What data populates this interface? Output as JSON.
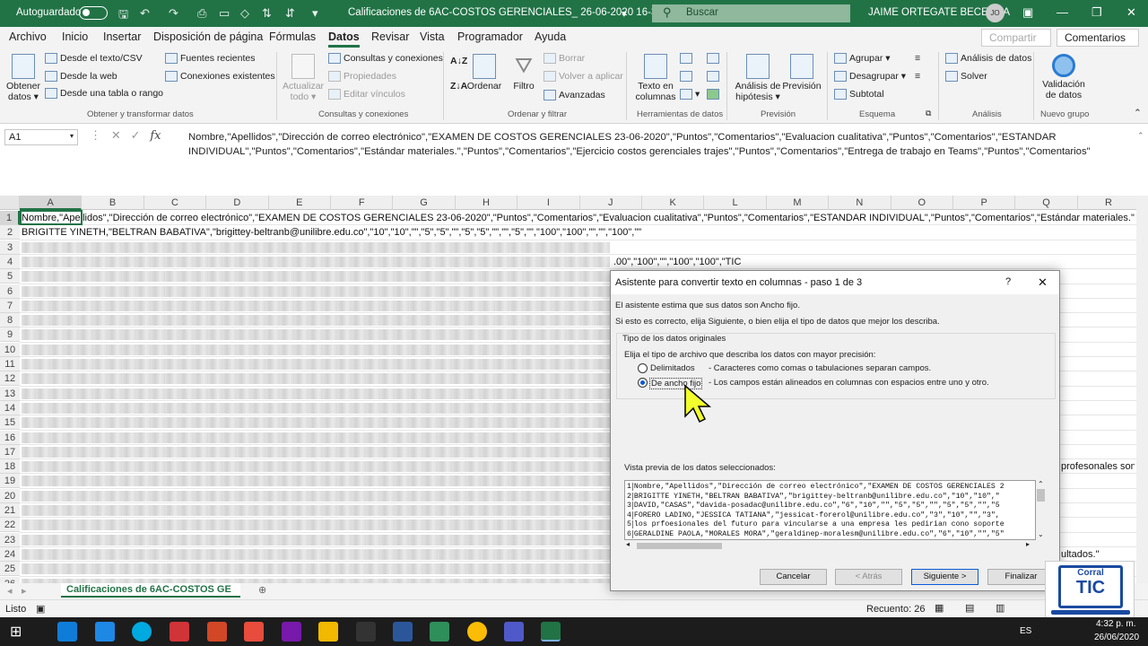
{
  "titlebar": {
    "autosave": "Autoguardado",
    "filename": "Calificaciones de 6AC-COSTOS GERENCIALES_ 26-06-2020 16-31.csv",
    "search": "Buscar",
    "user": "JAIME ORTEGATE BECERRA",
    "initials": "JO"
  },
  "menu": {
    "items": [
      "Archivo",
      "Inicio",
      "Insertar",
      "Disposición de página",
      "Fórmulas",
      "Datos",
      "Revisar",
      "Vista",
      "Programador",
      "Ayuda"
    ],
    "share": "Compartir",
    "comments": "Comentarios"
  },
  "ribbon": {
    "obtener": "Obtener",
    "datos": "datos",
    "desde_texto": "Desde el texto/CSV",
    "desde_web": "Desde la web",
    "desde_tabla": "Desde una tabla o rango",
    "fuentes": "Fuentes recientes",
    "conexiones": "Conexiones existentes",
    "g1": "Obtener y transformar datos",
    "actualizar": "Actualizar",
    "todo": "todo",
    "consultas": "Consultas y conexiones",
    "propiedades": "Propiedades",
    "editar": "Editar vínculos",
    "g2": "Consultas y conexiones",
    "ordenar": "Ordenar",
    "filtro": "Filtro",
    "borrar": "Borrar",
    "volver": "Volver a aplicar",
    "avanzadas": "Avanzadas",
    "g3": "Ordenar y filtrar",
    "texto": "Texto en",
    "columnas": "columnas",
    "g4": "Herramientas de datos",
    "analisis": "Análisis de",
    "hipotesis": "hipótesis",
    "prevision": "Previsión",
    "g5": "Previsión",
    "agrupar": "Agrupar",
    "desagrupar": "Desagrupar",
    "subtotal": "Subtotal",
    "g6": "Esquema",
    "analisis_datos": "Análisis de datos",
    "solver": "Solver",
    "g7": "Análisis",
    "validacion": "Validación",
    "de_datos": "de datos",
    "g8": "Nuevo grupo"
  },
  "formula": {
    "cell": "A1",
    "text": "Nombre,\"Apellidos\",\"Dirección de correo electrónico\",\"EXAMEN DE COSTOS GERENCIALES 23-06-2020\",\"Puntos\",\"Comentarios\",\"Evaluacion cualitativa\",\"Puntos\",\"Comentarios\",\"ESTANDAR INDIVIDUAL\",\"Puntos\",\"Comentarios\",\"Estándar materiales.\",\"Puntos\",\"Comentarios\",\"Ejercicio costos gerenciales trajes\",\"Puntos\",\"Comentarios\",\"Entrega de trabajo en Teams\",\"Puntos\",\"Comentarios\""
  },
  "columns": [
    "A",
    "B",
    "C",
    "D",
    "E",
    "F",
    "G",
    "H",
    "I",
    "J",
    "K",
    "L",
    "M",
    "N",
    "O",
    "P",
    "Q",
    "R"
  ],
  "rows": [
    "1",
    "2",
    "3",
    "4",
    "5",
    "6",
    "7",
    "8",
    "9",
    "10",
    "11",
    "12",
    "13",
    "14",
    "15",
    "16",
    "17",
    "18",
    "19",
    "20",
    "21",
    "22",
    "23",
    "24",
    "25",
    "26"
  ],
  "cells": {
    "r1": "Nombre,\"Apellidos\",\"Dirección de correo electrónico\",\"EXAMEN DE COSTOS GERENCIALES 23-06-2020\",\"Puntos\",\"Comentarios\",\"Evaluacion cualitativa\",\"Puntos\",\"Comentarios\",\"ESTANDAR INDIVIDUAL\",\"Puntos\",\"Comentarios\",\"Estándar materiales.\",\"Pu",
    "r2": "BRIGITTE YINETH,\"BELTRAN BABATIVA\",\"brigittey-beltranb@unilibre.edu.co\",\"10\",\"10\",\"\",\"5\",\"5\",\"\",\"5\",\"5\",\"\",\"\",\"5\",\"\",\"100\",\"100\",\"\",\"\",\"100\",\"\"",
    "r4": ".00\",\"100\",\"\",\"100\",\"100\",\"TIC",
    "r18": "profesonales son",
    "r24": "ultados.\""
  },
  "sheet": {
    "tab": "Calificaciones de 6AC-COSTOS GE"
  },
  "status": {
    "ready": "Listo",
    "count": "Recuento: 26"
  },
  "taskbar": {
    "lang": "ES",
    "time": "4:32 p. m.",
    "date": "26/06/2020"
  },
  "dialog": {
    "title": "Asistente para convertir texto en columnas - paso 1 de 3",
    "help": "?",
    "line1": "El asistente estima que sus datos son Ancho fijo.",
    "line2": "Si esto es correcto, elija Siguiente, o bien elija el tipo de datos que mejor los describa.",
    "group": "Tipo de los datos originales",
    "prompt": "Elija el tipo de archivo que describa los datos con mayor precisión:",
    "opt1": "Delimitados",
    "opt1desc": "- Caracteres como comas o tabulaciones separan campos.",
    "opt2": "De ancho fijo",
    "opt2desc": "- Los campos están alineados en columnas con espacios entre uno y otro.",
    "preview_label": "Vista previa de los datos seleccionados:",
    "preview": [
      "Nombre,\"Apellidos\",\"Dirección de correo electrónico\",\"EXAMEN DE COSTOS GERENCIALES 2",
      "BRIGITTE YINETH,\"BELTRAN BABATIVA\",\"brigittey-beltranb@unilibre.edu.co\",\"10\",\"10\",\"",
      "DAVID,\"CASAS\",\"davida-posadac@unilibre.edu.co\",\"6\",\"10\",\"\",\"5\",\"5\",\"\",\"5\",\"5\",\"\",\"5",
      "FORERO LADINO,\"JESSICA TATIANA\",\"jessicat-forerol@unilibre.edu.co\",\"3\",\"10\",\"\",\"3\",",
      "los prfoesionales del futuro para vincularse a una empresa les pedirian cono soporte",
      "GERALDINE PAOLA,\"MORALES MORA\",\"geraldinep-moralesm@unilibre.edu.co\",\"6\",\"10\",\"\",\"5\""
    ],
    "preview_nums": [
      "1",
      "2",
      "3",
      "4",
      "5",
      "6"
    ],
    "cancel": "Cancelar",
    "back": "< Atrás",
    "next": "Siguiente >",
    "finish": "Finalizar"
  },
  "logo": {
    "line1": "Corral",
    "line2": "TIC"
  }
}
